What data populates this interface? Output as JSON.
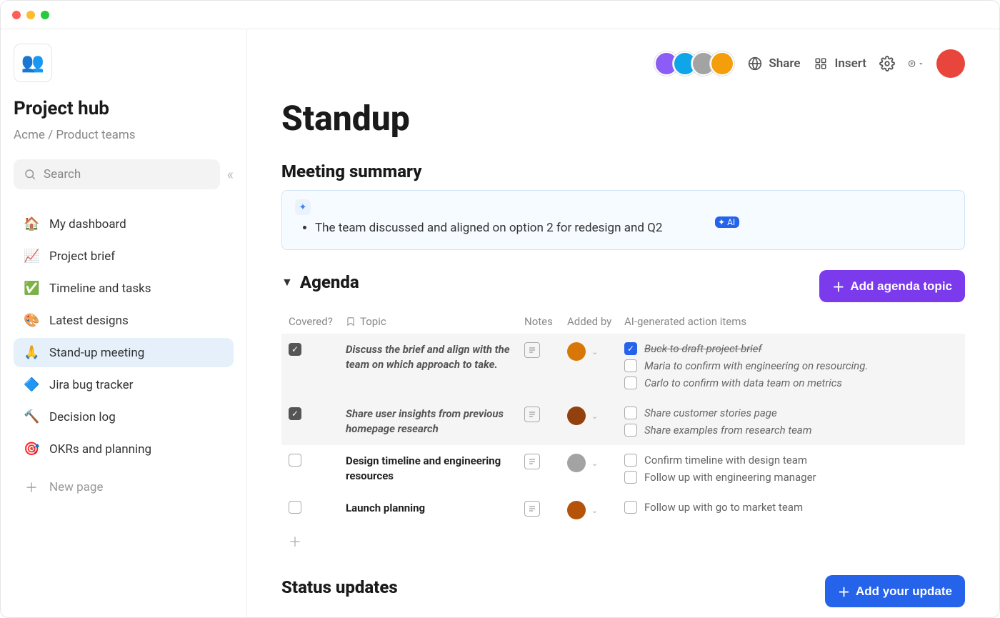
{
  "sidebar": {
    "workspace_emoji": "👥",
    "title": "Project hub",
    "breadcrumb": "Acme / Product teams",
    "search_placeholder": "Search",
    "items": [
      {
        "emoji": "🏠",
        "label": "My dashboard",
        "active": false
      },
      {
        "emoji": "📈",
        "label": "Project brief",
        "active": false
      },
      {
        "emoji": "✅",
        "label": "Timeline and tasks",
        "active": false
      },
      {
        "emoji": "🎨",
        "label": "Latest designs",
        "active": false
      },
      {
        "emoji": "🙏",
        "label": "Stand-up meeting",
        "active": true
      },
      {
        "emoji": "🔷",
        "label": "Jira bug tracker",
        "active": false
      },
      {
        "emoji": "🔨",
        "label": "Decision log",
        "active": false
      },
      {
        "emoji": "🎯",
        "label": "OKRs and planning",
        "active": false
      }
    ],
    "new_page_label": "New page"
  },
  "topbar": {
    "collaborator_colors": [
      "#8b5cf6",
      "#0ea5e9",
      "#a3a3a3",
      "#f59e0b"
    ],
    "share_label": "Share",
    "insert_label": "Insert",
    "user_avatar_color": "#e8453c"
  },
  "page": {
    "title": "Standup",
    "summary": {
      "heading": "Meeting summary",
      "bullet": "The team discussed and aligned on option 2 for redesign and Q2",
      "ai_badge": "AI"
    },
    "agenda": {
      "heading": "Agenda",
      "add_button": "Add agenda topic",
      "columns": {
        "covered": "Covered?",
        "topic": "Topic",
        "notes": "Notes",
        "added_by": "Added by",
        "ai_items": "AI-generated action items"
      },
      "rows": [
        {
          "covered": true,
          "shaded": true,
          "italic": true,
          "topic": "Discuss the brief and align with the team on which approach to take.",
          "avatar_color": "#d97706",
          "ai_items": [
            {
              "checked": true,
              "done": true,
              "italic": true,
              "text": "Buck to draft project brief"
            },
            {
              "checked": false,
              "done": false,
              "italic": true,
              "text": "Maria to confirm with engineering on resourcing."
            },
            {
              "checked": false,
              "done": false,
              "italic": true,
              "text": "Carlo to confirm with data team on metrics"
            }
          ]
        },
        {
          "covered": true,
          "shaded": true,
          "italic": true,
          "topic": "Share user insights from previous homepage research",
          "avatar_color": "#92400e",
          "ai_items": [
            {
              "checked": false,
              "done": false,
              "italic": true,
              "text": "Share customer stories page"
            },
            {
              "checked": false,
              "done": false,
              "italic": true,
              "text": "Share examples from research team"
            }
          ]
        },
        {
          "covered": false,
          "shaded": false,
          "italic": false,
          "topic": "Design timeline and engineering resources",
          "avatar_color": "#a3a3a3",
          "ai_items": [
            {
              "checked": false,
              "done": false,
              "italic": false,
              "text": "Confirm timeline with design team"
            },
            {
              "checked": false,
              "done": false,
              "italic": false,
              "text": "Follow up with engineering manager"
            }
          ]
        },
        {
          "covered": false,
          "shaded": false,
          "italic": false,
          "topic": "Launch planning",
          "avatar_color": "#b45309",
          "ai_items": [
            {
              "checked": false,
              "done": false,
              "italic": false,
              "text": "Follow up with go to market team"
            }
          ]
        }
      ]
    },
    "status": {
      "heading": "Status updates",
      "add_button": "Add your update"
    }
  }
}
